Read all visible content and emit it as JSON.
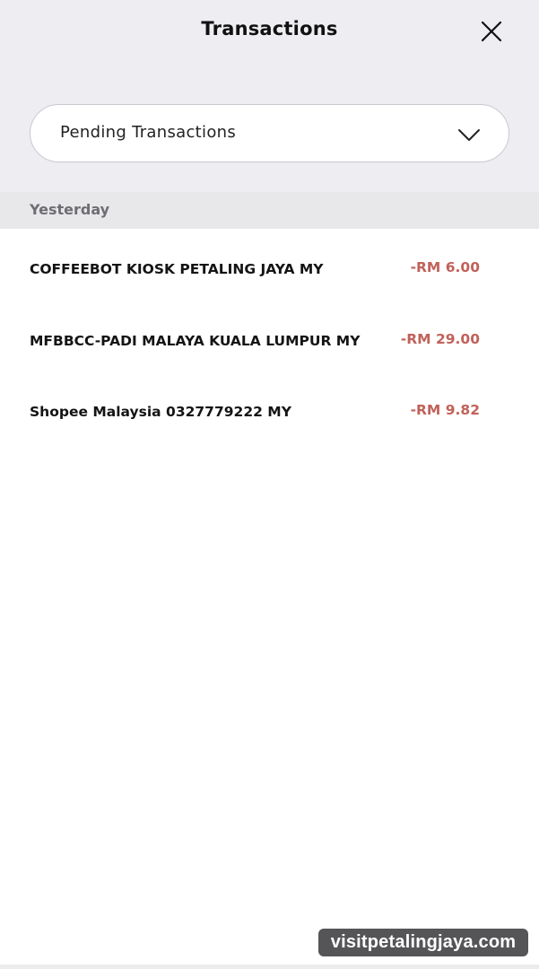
{
  "header": {
    "title": "Transactions",
    "close_icon": "close-icon"
  },
  "filter": {
    "selected": "Pending Transactions",
    "chevron_icon": "chevron-down-icon"
  },
  "section": {
    "label": "Yesterday"
  },
  "transactions": [
    {
      "merchant": "COFFEEBOT KIOSK PETALING JAYA MY",
      "amount": "-RM 6.00"
    },
    {
      "merchant": "MFBBCC-PADI MALAYA KUALA LUMPUR MY",
      "amount": "-RM 29.00"
    },
    {
      "merchant": "Shopee Malaysia 0327779222 MY",
      "amount": "-RM 9.82"
    }
  ],
  "watermark": {
    "text": "visitpetalingjaya.com"
  },
  "colors": {
    "header_bg": "#ededf2",
    "section_bg": "#e8e8ea",
    "amount_negative": "#c0625a",
    "text_primary": "#141414",
    "text_secondary": "#6d6d73"
  }
}
